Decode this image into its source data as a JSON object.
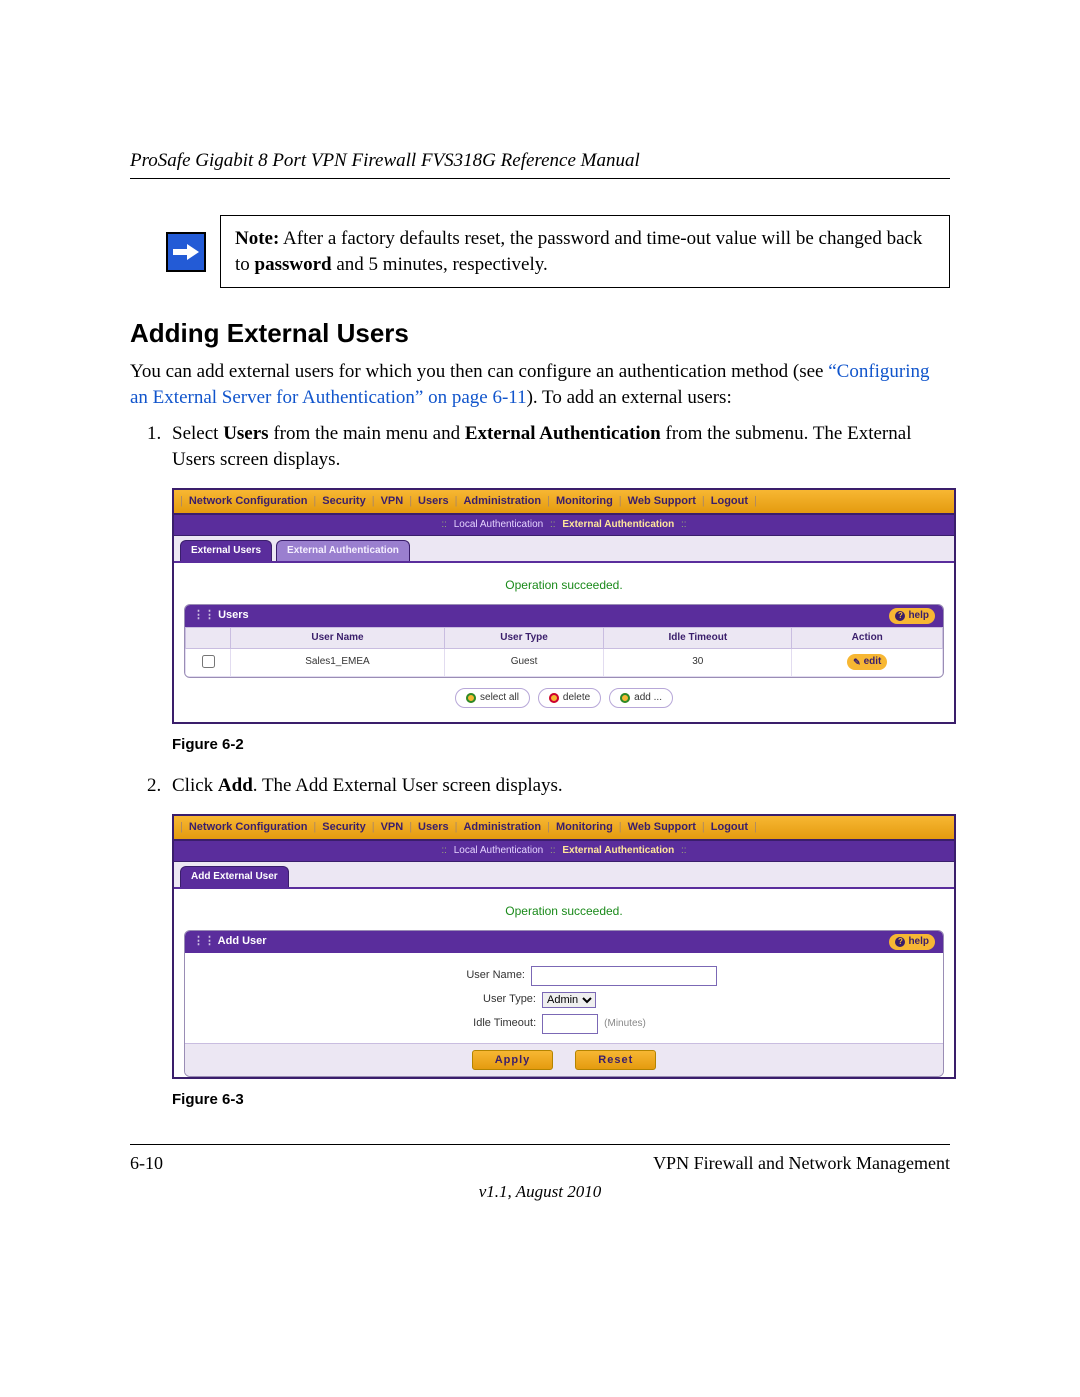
{
  "header": {
    "doc_title": "ProSafe Gigabit 8 Port VPN Firewall FVS318G Reference Manual"
  },
  "note": {
    "label": "Note:",
    "text_a": " After a factory defaults reset, the password and time-out value will be changed back to ",
    "bold": "password",
    "text_b": " and 5 minutes, respectively."
  },
  "section": {
    "heading": "Adding External Users",
    "intro_a": "You can add external users for which you then can configure an authentication method (see ",
    "xref": "“Configuring an External Server for Authentication” on page 6-11",
    "intro_b": "). To add an external users:"
  },
  "steps": {
    "s1_a": "Select ",
    "s1_b1": "Users",
    "s1_c": " from the main menu and ",
    "s1_b2": "External Authentication",
    "s1_d": " from the submenu. The External Users screen displays.",
    "s2_a": "Click ",
    "s2_b": "Add",
    "s2_c": ". The Add External User screen displays."
  },
  "figure1": {
    "caption": "Figure 6-2",
    "menu": [
      "Network Configuration",
      "Security",
      "VPN",
      "Users",
      "Administration",
      "Monitoring",
      "Web Support",
      "Logout"
    ],
    "submenu": {
      "a": "Local Authentication",
      "b": "External Authentication"
    },
    "tabs": {
      "active": "External Users",
      "inactive": "External Authentication"
    },
    "status": "Operation succeeded.",
    "panel_title": "Users",
    "help": "help",
    "columns": [
      "User Name",
      "User Type",
      "Idle Timeout",
      "Action"
    ],
    "row": {
      "user": "Sales1_EMEA",
      "type": "Guest",
      "timeout": "30",
      "action": "edit"
    },
    "buttons": {
      "select_all": "select all",
      "delete": "delete",
      "add": "add ..."
    }
  },
  "figure2": {
    "caption": "Figure 6-3",
    "menu": [
      "Network Configuration",
      "Security",
      "VPN",
      "Users",
      "Administration",
      "Monitoring",
      "Web Support",
      "Logout"
    ],
    "submenu": {
      "a": "Local Authentication",
      "b": "External Authentication"
    },
    "tab": "Add External User",
    "status": "Operation succeeded.",
    "panel_title": "Add User",
    "help": "help",
    "labels": {
      "username": "User Name:",
      "usertype": "User Type:",
      "timeout": "Idle Timeout:"
    },
    "usertype_value": "Admin",
    "minutes_hint": "(Minutes)",
    "apply": "Apply",
    "reset": "Reset"
  },
  "footer": {
    "page": "6-10",
    "section": "VPN Firewall and Network Management",
    "version": "v1.1, August 2010"
  }
}
